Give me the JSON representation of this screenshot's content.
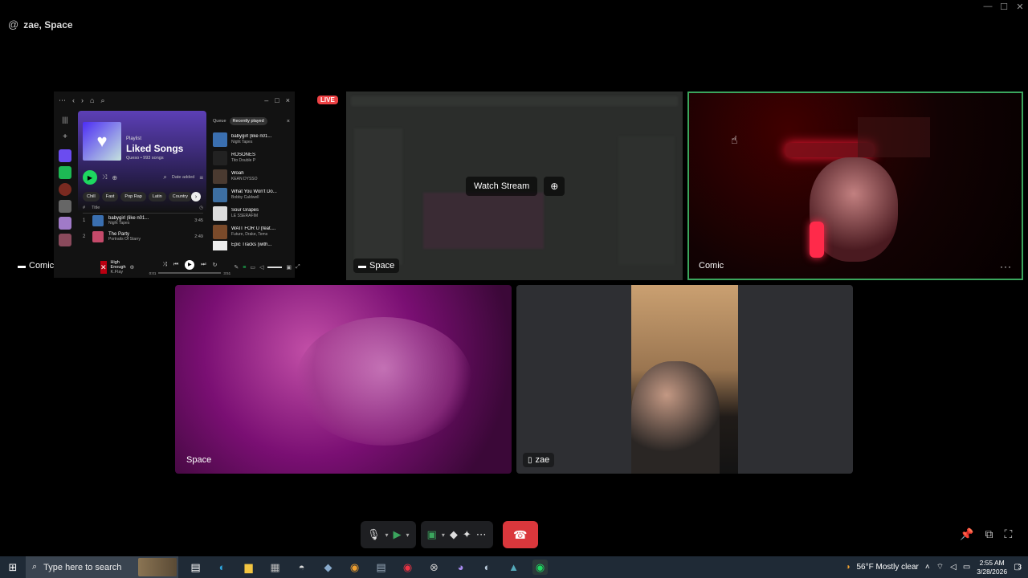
{
  "window": {
    "min": "—",
    "max": "☐",
    "close": "✕"
  },
  "channel": {
    "at": "@",
    "name": "zae, Space"
  },
  "spotify": {
    "playlist_type": "Playlist",
    "playlist_title": "Liked Songs",
    "playlist_meta": "Queso • 993 songs",
    "date_added": "Date added",
    "chips": [
      "Chill",
      "Fast",
      "Pop Rap",
      "Latin",
      "Country"
    ],
    "table_hash": "#",
    "table_title": "Title",
    "tracks": [
      {
        "n": "1",
        "title": "babygirl (like n01...",
        "artist": "Night Tapes",
        "dur": "3:45"
      },
      {
        "n": "2",
        "title": "The Party",
        "artist": "Portraits Of Starry",
        "dur": "2:49"
      }
    ],
    "queue_tab": "Queue",
    "recent_tab": "Recently played",
    "queue": [
      {
        "title": "babygirl (like n01...",
        "artist": "Night Tapes"
      },
      {
        "title": "ROSONES",
        "artist": "Tito Double P"
      },
      {
        "title": "Woah",
        "artist": "KEAN DYSSO"
      },
      {
        "title": "What You Won't Do...",
        "artist": "Bobby Caldwell"
      },
      {
        "title": "Sour Grapes",
        "artist": "LE SSERAFIM"
      },
      {
        "title": "WAIT FOR U (feat....",
        "artist": "Future, Drake, Tems"
      },
      {
        "title": "Epic Tracks (with...",
        "artist": ""
      }
    ],
    "now_playing_title": "High Enough",
    "now_playing_artist": "K.Flay",
    "time_elapsed": "0:01",
    "time_total": "3:51"
  },
  "live_badge": "LIVE",
  "watch_stream": "Watch Stream",
  "tiles": {
    "comic_share": "Comic",
    "space_share": "Space",
    "comic_cam": "Comic",
    "space_cam": "Space",
    "zae_cam": "zae"
  },
  "more_dots": "···",
  "taskbar": {
    "search_placeholder": "Type here to search",
    "weather": "56°F  Mostly clear",
    "time": "2:55 AM",
    "date": "3/28/2026",
    "notifications": "3"
  },
  "colors": {
    "accent_green": "#3ba55d",
    "end_call": "#da373c",
    "spotify_green": "#1ed760",
    "live": "#ed4245"
  }
}
